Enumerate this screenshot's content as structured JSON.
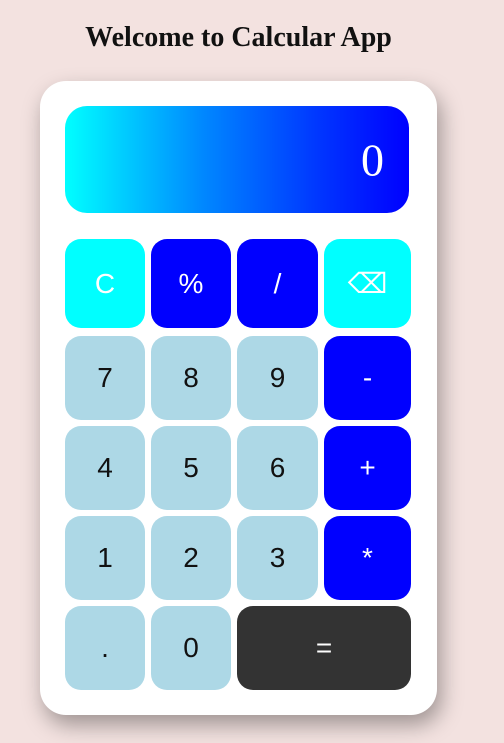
{
  "page": {
    "title": "Welcome to Calcular App"
  },
  "display": {
    "value": "0"
  },
  "keys": {
    "clear": "C",
    "percent": "%",
    "divide": "/",
    "backspace": "⌫",
    "seven": "7",
    "eight": "8",
    "nine": "9",
    "minus": "-",
    "four": "4",
    "five": "5",
    "six": "6",
    "plus": "+",
    "one": "1",
    "two": "2",
    "three": "3",
    "multiply": "*",
    "decimal": ".",
    "zero": "0",
    "equals": "="
  },
  "colors": {
    "background": "#f3e2e0",
    "card": "#ffffff",
    "cyan_key": "#00ffff",
    "blue_key": "#0000ff",
    "digit_key": "#add8e6",
    "equals_key": "#333333",
    "display_gradient_start": "#00ffff",
    "display_gradient_end": "#0000ff"
  }
}
